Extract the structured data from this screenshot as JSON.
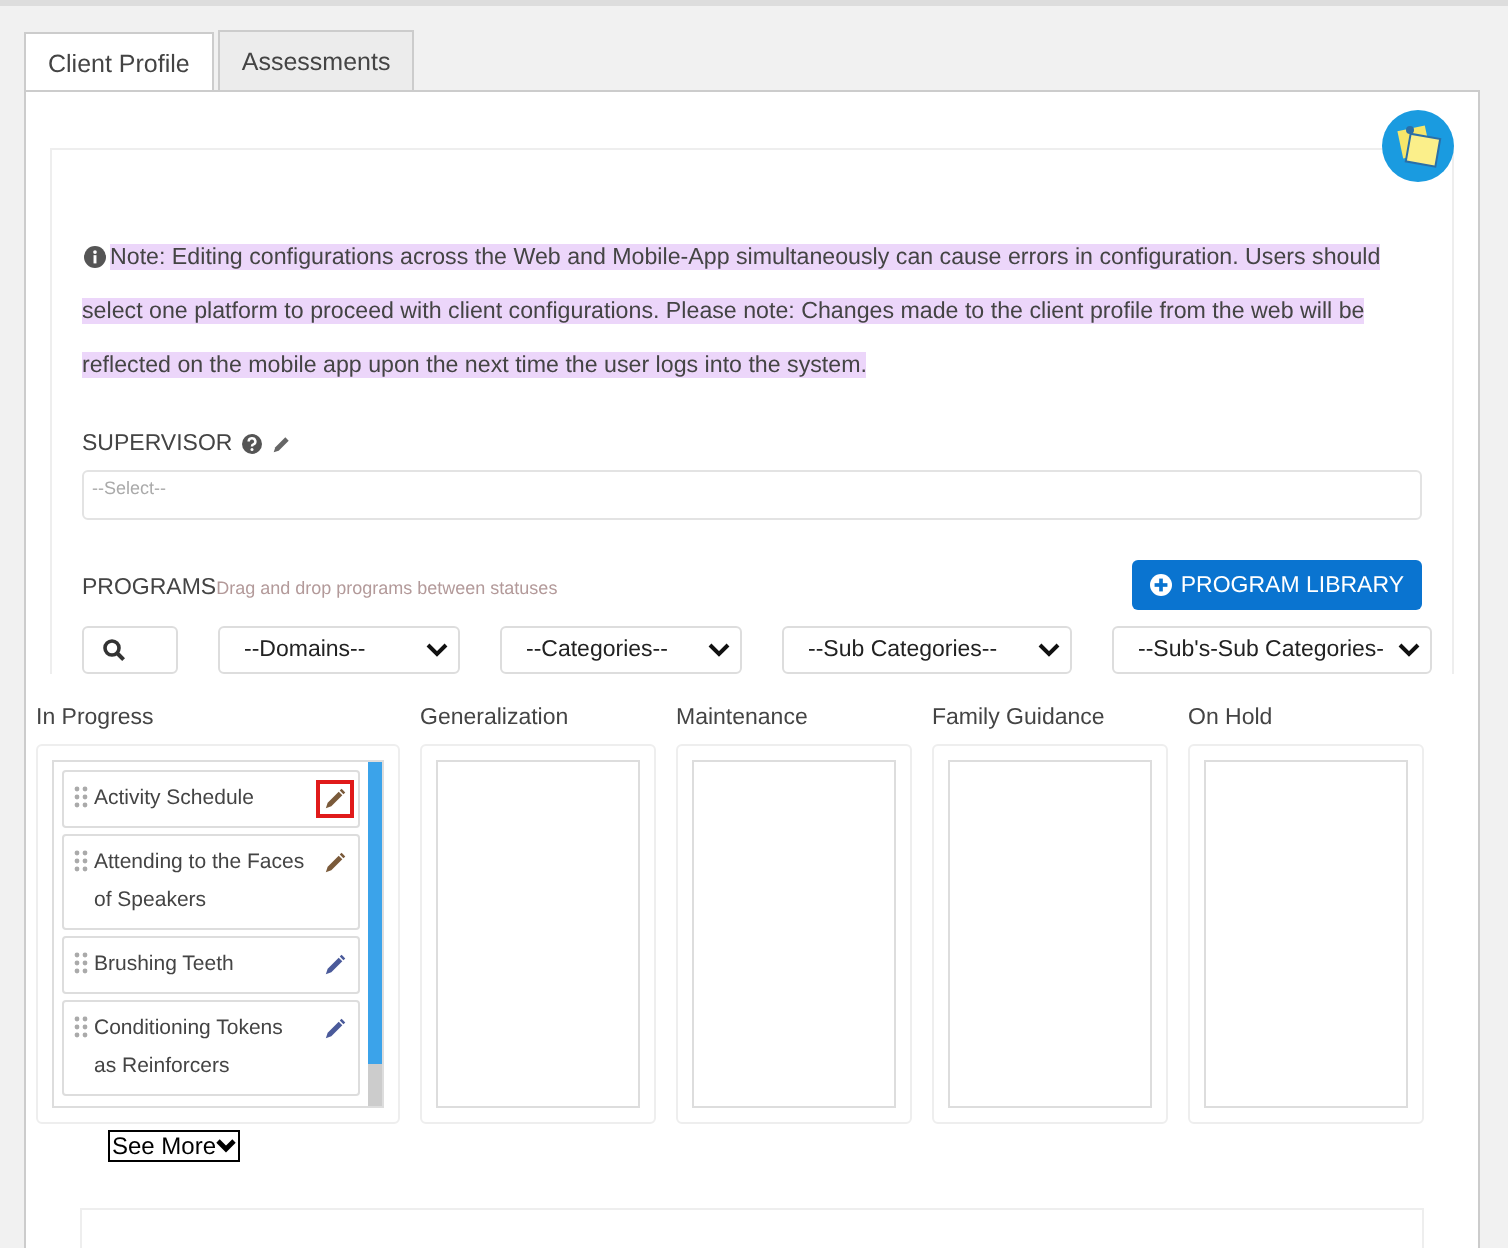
{
  "tabs": [
    {
      "label": "Client Profile",
      "selected": true
    },
    {
      "label": "Assessments",
      "selected": false
    }
  ],
  "note": "Note: Editing configurations across the Web and Mobile-App simultaneously can cause errors in configuration. Users should select one platform to proceed with client configurations. Please note: Changes made to the client profile from the web will be reflected on the mobile app upon the next time the user logs into the system.",
  "supervisor": {
    "label": "SUPERVISOR",
    "placeholder": "--Select--"
  },
  "programs": {
    "label": "PROGRAMS",
    "hint": "Drag and drop programs between statuses",
    "library_button": "PROGRAM LIBRARY"
  },
  "filters": [
    "--Domains--",
    "--Categories--",
    "--Sub Categories--",
    "--Sub's-Sub Categories-"
  ],
  "columns": [
    {
      "title": "In Progress",
      "items": [
        {
          "name": "Activity Schedule",
          "color": "#7a5a3a",
          "highlighted": true
        },
        {
          "name": "Attending to the Faces of Speakers",
          "color": "#7a5a3a",
          "highlighted": false
        },
        {
          "name": "Brushing Teeth",
          "color": "#4a5a9a",
          "highlighted": false
        },
        {
          "name": "Conditioning Tokens as Reinforcers",
          "color": "#4a5a9a",
          "highlighted": false
        }
      ]
    },
    {
      "title": "Generalization"
    },
    {
      "title": "Maintenance"
    },
    {
      "title": "Family Guidance"
    },
    {
      "title": "On Hold"
    }
  ],
  "see_more": "See More"
}
